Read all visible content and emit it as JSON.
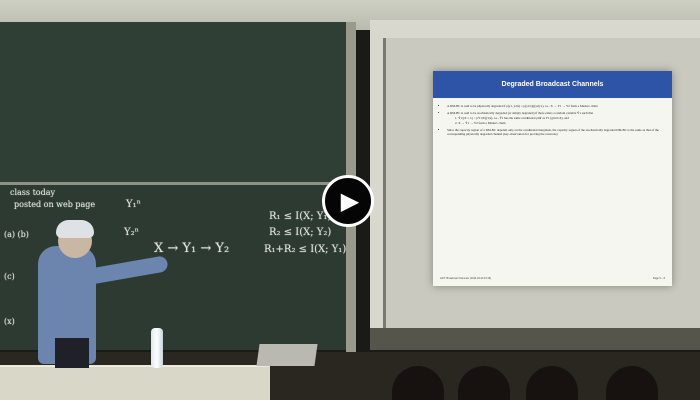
{
  "slide": {
    "title": "Degraded Broadcast Channels",
    "bullet1": "A DM-BC is said to be physically degraded if p(y1, y2|x) = p(y1|x)p(y2|y1), i.e., X → Y1 → Y2 form a Markov chain",
    "bullet2": "A DM-BC is said to be stochastically degraded (or simply degraded) if there exists a random variable Ỹ1 such that",
    "sub1": "1. Ỹ1|{X = x} ~ pY1|X(ỹ1|x), i.e., Ỹ1 has the same conditional pmf as Y1 (given X), and",
    "sub2": "2. X → Ỹ1 → Y2 form a Markov chain",
    "bullet3": "Since the capacity region of a DM-BC depends only on the conditional marginals, the capacity region of the stochastically degraded DM-BC is the same as that of the corresponding physically degraded channel (key observation for proving the converse)",
    "footer_left": "LNIT: Broadcast Channels (2010-03-20 15:16)",
    "footer_right": "Page 5 – 8"
  },
  "blackboard": {
    "line1": "class today",
    "line2": "posted on web page",
    "line3": "(a) (b)",
    "line4": "(c)",
    "line5": "(x)",
    "label_y1": "Y₁ⁿ",
    "label_y2": "Y₂ⁿ",
    "markov": "X → Y₁ → Y₂",
    "eq1": "R₁ ≤ I(X; Y₁)",
    "eq2": "R₂ ≤ I(X; Y₂)",
    "eq3": "R₁+R₂ ≤ I(X; Y₁)"
  },
  "player": {
    "play_glyph": "▶"
  }
}
